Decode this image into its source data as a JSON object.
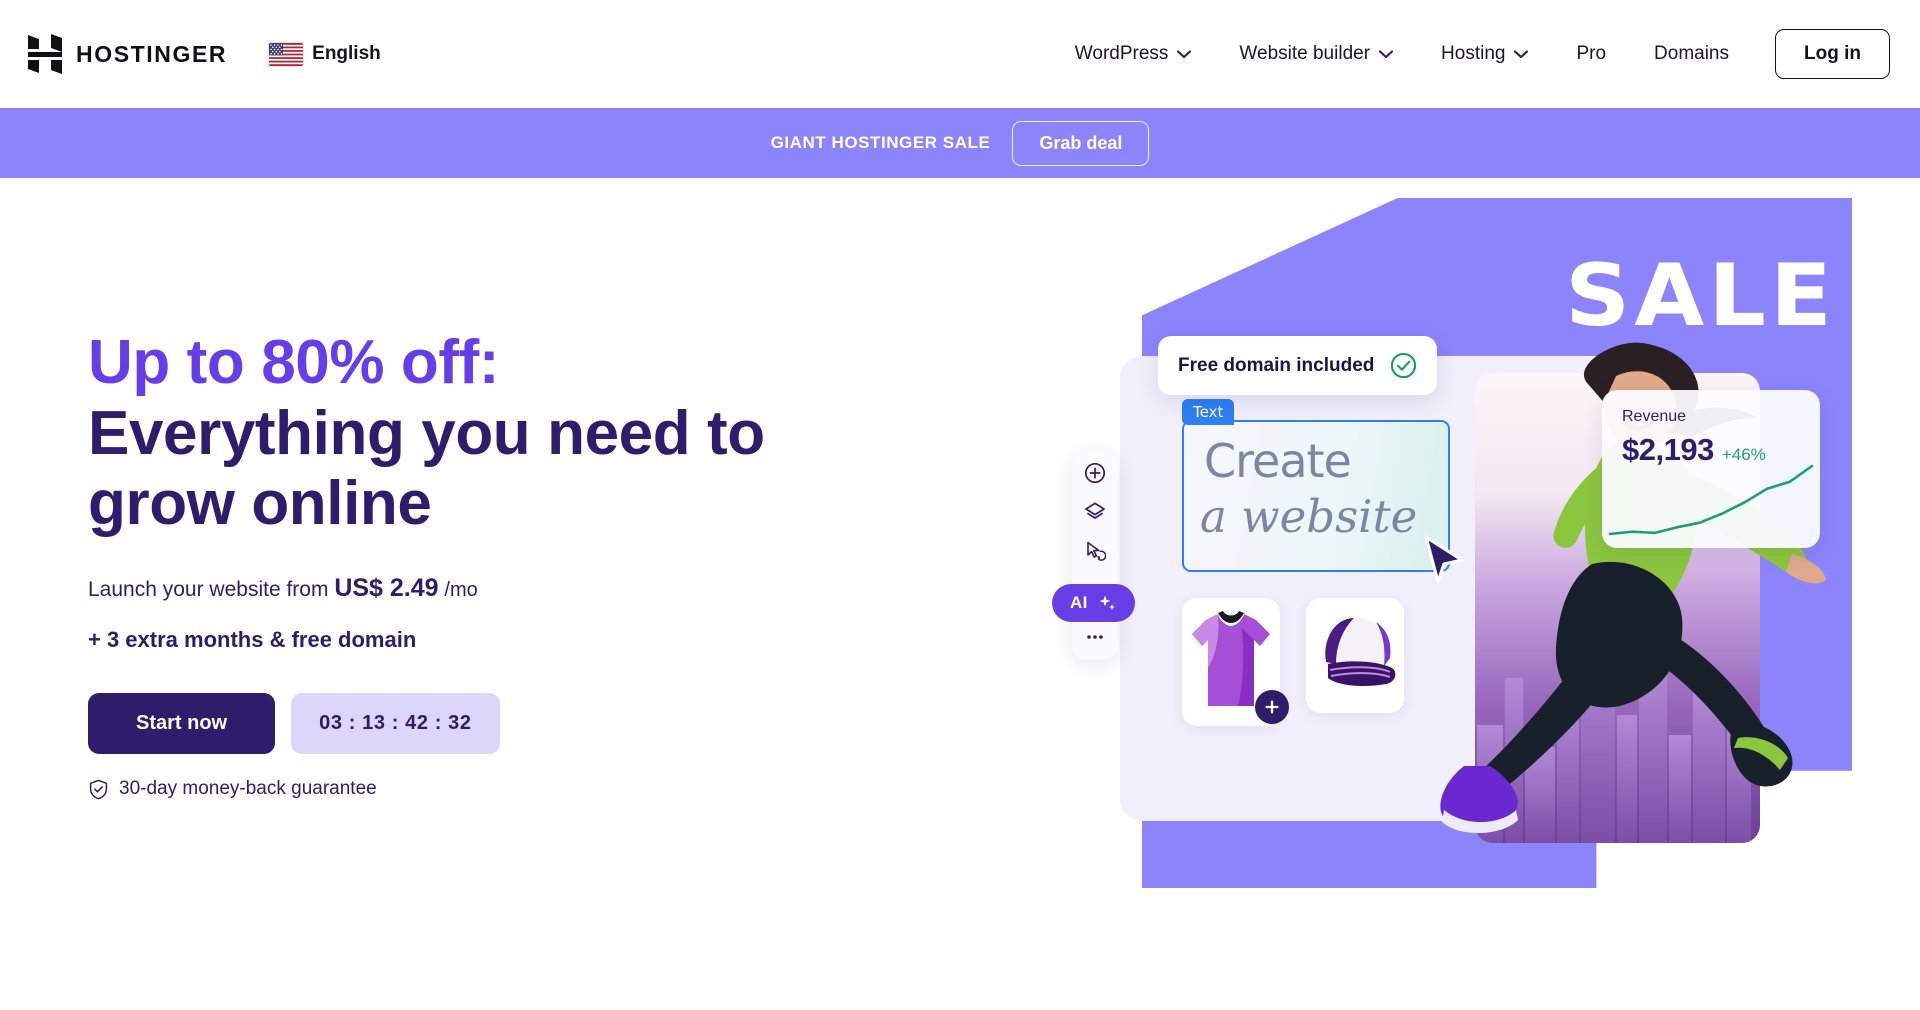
{
  "header": {
    "brand_name": "HOSTINGER",
    "logo_icon": "hostinger-h-logo",
    "language": {
      "label": "English",
      "flag_icon": "us-flag-icon"
    },
    "nav": [
      {
        "label": "WordPress",
        "has_dropdown": true,
        "icon": "chevron-down-icon"
      },
      {
        "label": "Website builder",
        "has_dropdown": true,
        "icon": "chevron-down-icon"
      },
      {
        "label": "Hosting",
        "has_dropdown": true,
        "icon": "chevron-down-icon"
      },
      {
        "label": "Pro",
        "has_dropdown": false
      },
      {
        "label": "Domains",
        "has_dropdown": false
      }
    ],
    "login_label": "Log in"
  },
  "promo_banner": {
    "text": "GIANT HOSTINGER SALE",
    "button_label": "Grab deal",
    "background_color": "#8b84fb"
  },
  "hero": {
    "headline_accent": "Up to 80% off:",
    "headline_line2": "Everything you need to",
    "headline_line3": "grow online",
    "accent_color": "#673de6",
    "headline_color": "#2f1c6a",
    "price_prefix": "Launch your website from",
    "price_amount": "US$ 2.49",
    "price_period": "/mo",
    "bonus": "+ 3 extra months & free domain",
    "cta_label": "Start now",
    "countdown": "03 : 13 : 42 : 32",
    "guarantee": "30-day money-back guarantee",
    "guarantee_icon": "shield-check-icon"
  },
  "artwork": {
    "sale_word": "SALE",
    "domain_badge": {
      "text": "Free domain included",
      "icon": "green-check-circle-icon"
    },
    "editor": {
      "tag": "Text",
      "line1": "Create",
      "line2": "a website",
      "cursor_icon": "mouse-pointer-icon"
    },
    "toolbar": [
      {
        "icon": "plus-circle-icon"
      },
      {
        "icon": "layers-icon"
      },
      {
        "icon": "cursor-palette-icon"
      },
      {
        "icon": "more-horizontal-icon"
      }
    ],
    "ai_button": {
      "label": "AI",
      "icon": "sparkles-icon"
    },
    "products": [
      {
        "name": "purple-tshirt",
        "badge_icon": "plus-icon"
      },
      {
        "name": "purple-cap"
      }
    ],
    "revenue_card": {
      "label": "Revenue",
      "amount": "$2,193",
      "delta": "+46%",
      "delta_color": "#19a07a"
    }
  },
  "chart_data": {
    "type": "line",
    "title": "Revenue",
    "values": [
      12,
      14,
      13,
      18,
      22,
      30,
      40,
      52,
      58,
      72
    ],
    "x": [
      1,
      2,
      3,
      4,
      5,
      6,
      7,
      8,
      9,
      10
    ],
    "ylabel": "",
    "xlabel": "",
    "legend": [],
    "grid": false,
    "series_color": "#19a07a"
  }
}
